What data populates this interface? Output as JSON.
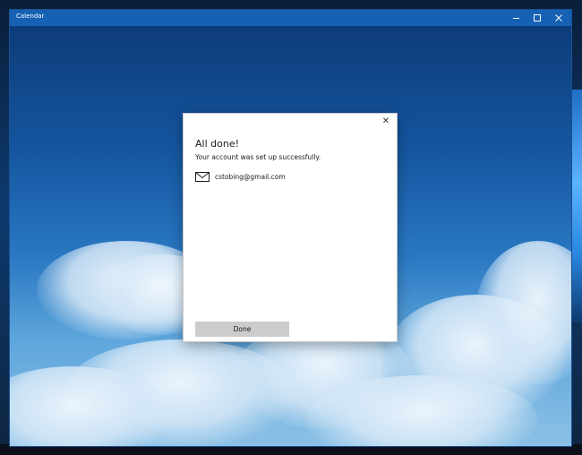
{
  "window": {
    "title": "Calendar",
    "titlebar_color": "#1661b3"
  },
  "icons": {
    "minimize": "minimize-icon",
    "maximize": "maximize-icon",
    "close": "close-icon",
    "mail": "mail-icon"
  },
  "dialog": {
    "close_glyph": "✕",
    "title": "All done!",
    "message": "Your account was set up successfully.",
    "account_email": "cstobing@gmail.com",
    "done_label": "Done",
    "done_button_color": "#cccccc"
  }
}
